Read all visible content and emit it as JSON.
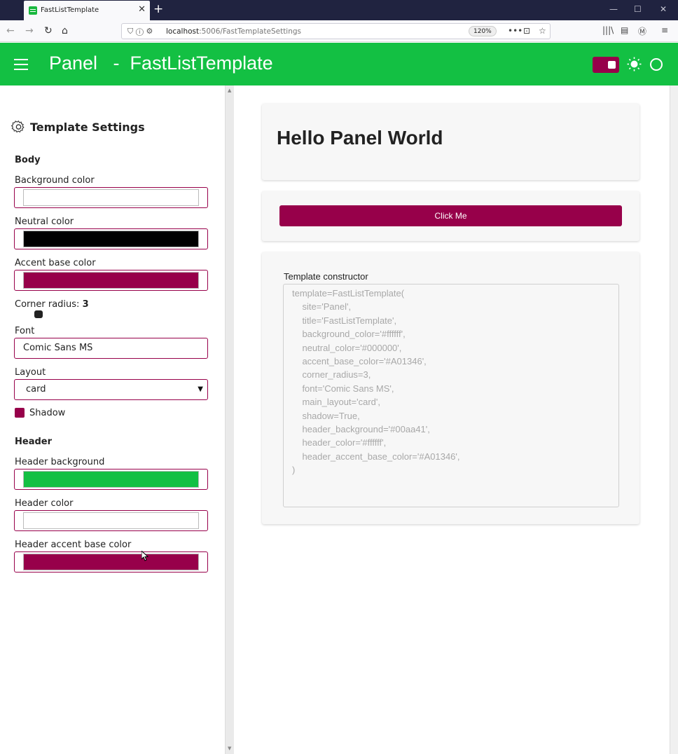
{
  "browser": {
    "tab_title": "FastListTemplate",
    "url_host": "localhost",
    "url_path": ":5006/FastTemplateSettings",
    "zoom": "120%"
  },
  "header": {
    "title": "Panel   -  FastListTemplate",
    "background": "#13c043",
    "accent": "#97004a"
  },
  "sidebar": {
    "title": "Template Settings",
    "body_section": "Body",
    "background_color_label": "Background color",
    "background_color_value": "#ffffff",
    "neutral_color_label": "Neutral color",
    "neutral_color_value": "#000000",
    "accent_color_label": "Accent base color",
    "accent_color_value": "#97004a",
    "corner_radius_label": "Corner radius: ",
    "corner_radius_value": "3",
    "font_label": "Font",
    "font_value": "Comic Sans MS",
    "layout_label": "Layout",
    "layout_value": "card",
    "shadow_label": "Shadow",
    "shadow_checked": true,
    "header_section": "Header",
    "header_bg_label": "Header background",
    "header_bg_value": "#13c043",
    "header_color_label": "Header color",
    "header_color_value": "#ffffff",
    "header_accent_label": "Header accent base color",
    "header_accent_value": "#97004a"
  },
  "main": {
    "hello": "Hello Panel World",
    "button_label": "Click Me",
    "constructor_label": "Template constructor",
    "constructor_lines": [
      "template=FastListTemplate(",
      "    site='Panel',",
      "    title='FastListTemplate',",
      "    background_color='#ffffff',",
      "    neutral_color='#000000',",
      "    accent_base_color='#A01346',",
      "    corner_radius=3,",
      "    font='Comic Sans MS',",
      "    main_layout='card',",
      "    shadow=True,",
      "    header_background='#00aa41',",
      "    header_color='#ffffff',",
      "    header_accent_base_color='#A01346',",
      ")"
    ]
  }
}
